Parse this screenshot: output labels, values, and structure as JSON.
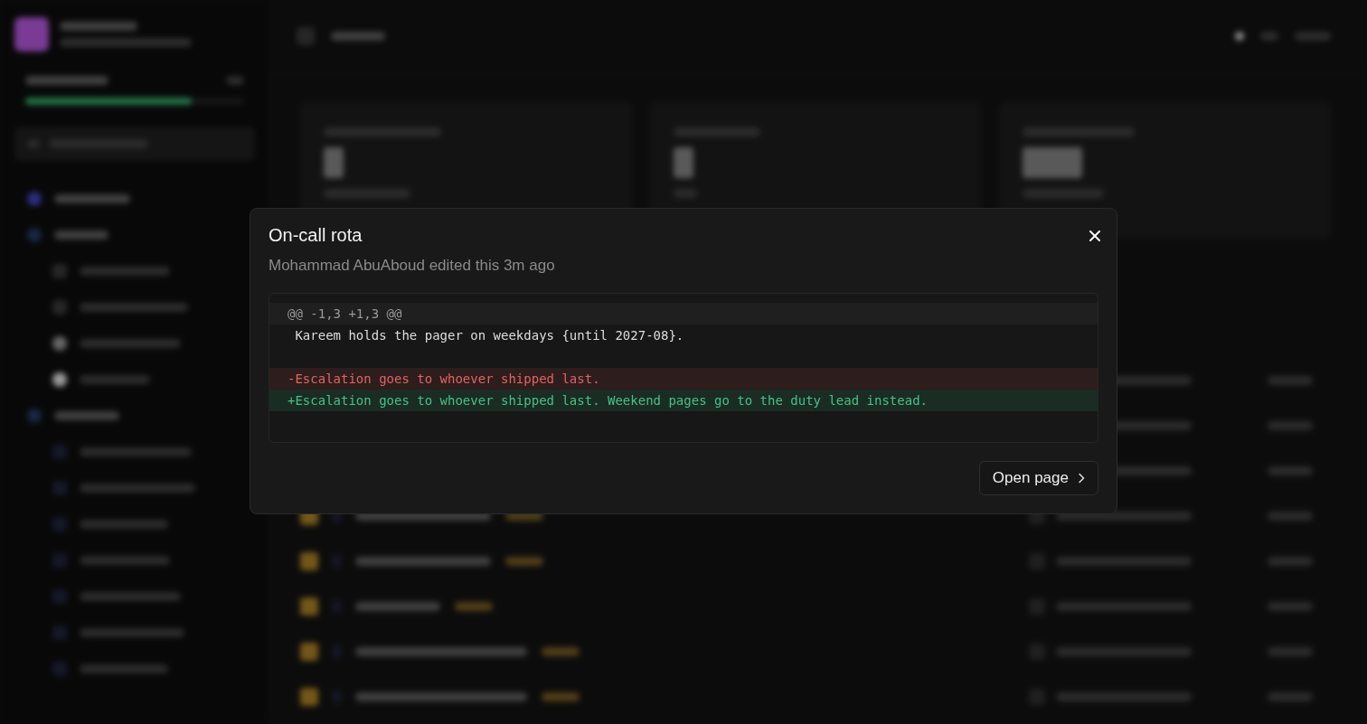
{
  "modal": {
    "title": "On-call rota",
    "subtitle": "Mohammad AbuAboud edited this 3m ago",
    "diff": [
      {
        "kind": "hunk",
        "text": "@@ -1,3 +1,3 @@"
      },
      {
        "kind": "context",
        "text": " Kareem holds the pager on weekdays {until 2027-08}."
      },
      {
        "kind": "blank"
      },
      {
        "kind": "removed",
        "text": "-Escalation goes to whoever shipped last."
      },
      {
        "kind": "added",
        "text": "+Escalation goes to whoever shipped last. Weekend pages go to the duty lead instead."
      },
      {
        "kind": "blank"
      }
    ],
    "button": "Open page"
  }
}
